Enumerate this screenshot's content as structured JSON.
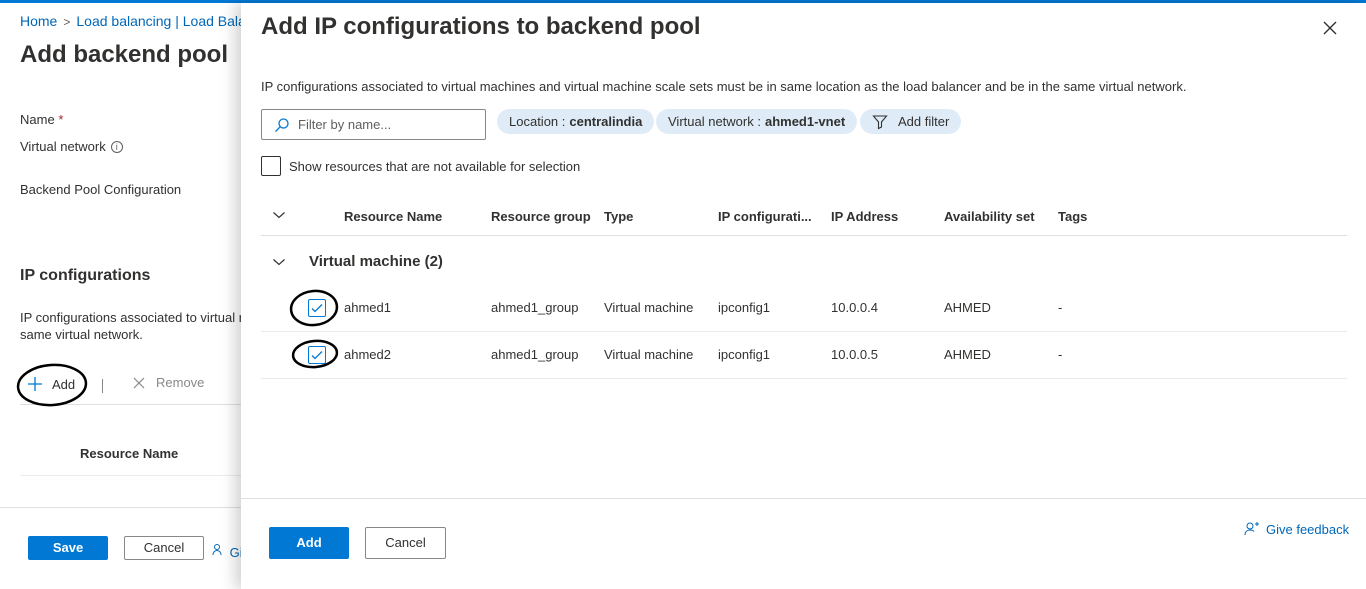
{
  "breadcrumb": {
    "home": "Home",
    "separator": ">",
    "current": "Load balancing | Load Bala"
  },
  "background_page": {
    "title": "Add backend pool",
    "name_label": "Name",
    "required_mark": "*",
    "vnet_label": "Virtual network",
    "info_icon": "i",
    "backend_pool_config_label": "Backend Pool Configuration",
    "ip_config_heading": "IP configurations",
    "ip_config_desc_line1": "IP configurations associated to virtual r",
    "ip_config_desc_line2": "same virtual network.",
    "add_label": "Add",
    "remove_label": "Remove",
    "column_resource_name": "Resource Name",
    "save_label": "Save",
    "cancel_label": "Cancel",
    "feedback_partial": "Giv"
  },
  "panel": {
    "title": "Add IP configurations to backend pool",
    "description": "IP configurations associated to virtual machines and virtual machine scale sets must be in same location as the load balancer and be in the same virtual network.",
    "filter_placeholder": "Filter by name...",
    "pill_location_key": "Location :",
    "pill_location_value": "centralindia",
    "pill_vnet_key": "Virtual network :",
    "pill_vnet_value": "ahmed1-vnet",
    "add_filter_label": "Add filter",
    "show_unavailable_label": "Show resources that are not available for selection",
    "columns": {
      "resource_name": "Resource Name",
      "resource_group": "Resource group",
      "type": "Type",
      "ip_configuration": "IP configurati...",
      "ip_address": "IP Address",
      "availability_set": "Availability set",
      "tags": "Tags"
    },
    "group_label": "Virtual machine (2)",
    "rows": [
      {
        "name": "ahmed1",
        "group": "ahmed1_group",
        "type": "Virtual machine",
        "ipconfig": "ipconfig1",
        "ip": "10.0.0.4",
        "avset": "AHMED",
        "tags": "-",
        "checked": true
      },
      {
        "name": "ahmed2",
        "group": "ahmed1_group",
        "type": "Virtual machine",
        "ipconfig": "ipconfig1",
        "ip": "10.0.0.5",
        "avset": "AHMED",
        "tags": "-",
        "checked": true
      }
    ],
    "add_button": "Add",
    "cancel_button": "Cancel",
    "feedback_label": "Give feedback"
  },
  "colors": {
    "accent": "#0078d4",
    "link": "#0067b8",
    "pill_bg": "#dfecf7"
  }
}
